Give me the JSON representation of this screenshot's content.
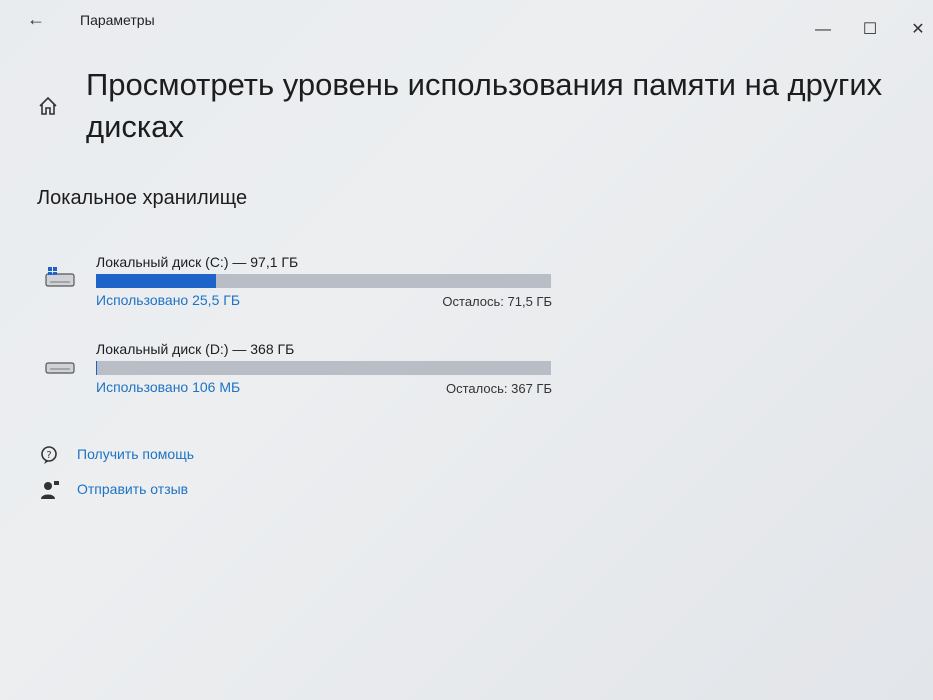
{
  "window": {
    "app_title": "Параметры",
    "back_icon": "arrow-left-icon",
    "controls": {
      "minimize": "—",
      "maximize": "☐",
      "close": "✕"
    }
  },
  "page": {
    "title": "Просмотреть уровень использования памяти на других дисках",
    "section_title": "Локальное хранилище"
  },
  "disks": [
    {
      "name": "Локальный диск (C:) — 97,1 ГБ",
      "used_label": "Использовано 25,5 ГБ",
      "free_label": "Осталось: 71,5 ГБ",
      "used_fraction": 0.263,
      "icon": "windows-drive-icon"
    },
    {
      "name": "Локальный диск (D:) — 368 ГБ",
      "used_label": "Использовано 106 МБ",
      "free_label": "Осталось: 367 ГБ",
      "used_fraction": 0.0003,
      "icon": "drive-icon"
    }
  ],
  "links": {
    "help": "Получить помощь",
    "feedback": "Отправить отзыв"
  },
  "colors": {
    "accent": "#1e64c8",
    "link": "#1f73c4",
    "bar_track": "#b9bec6"
  }
}
